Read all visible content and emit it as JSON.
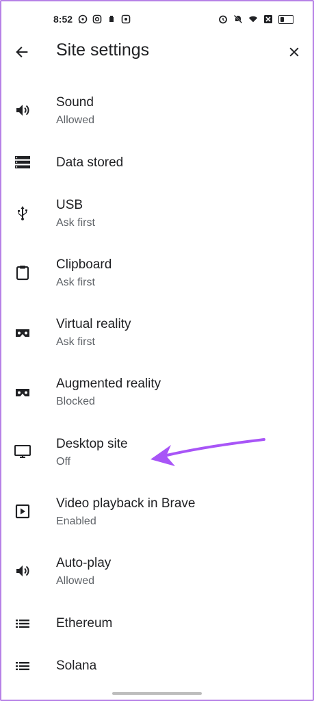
{
  "status_bar": {
    "time": "8:52",
    "left_icons": [
      "whatsapp-icon",
      "instagram-icon",
      "notification-icon",
      "app-icon"
    ],
    "right_icons": [
      "alarm-icon",
      "mute-icon",
      "wifi-icon",
      "signal-off-icon",
      "battery-icon"
    ]
  },
  "header": {
    "title": "Site settings",
    "back_icon": "arrow-back-icon",
    "close_icon": "close-icon"
  },
  "settings": [
    {
      "title": "Sound",
      "subtitle": "Allowed",
      "icon": "volume-icon"
    },
    {
      "title": "Data stored",
      "subtitle": "",
      "icon": "storage-icon"
    },
    {
      "title": "USB",
      "subtitle": "Ask first",
      "icon": "usb-icon"
    },
    {
      "title": "Clipboard",
      "subtitle": "Ask first",
      "icon": "clipboard-icon"
    },
    {
      "title": "Virtual reality",
      "subtitle": "Ask first",
      "icon": "vr-headset-icon"
    },
    {
      "title": "Augmented reality",
      "subtitle": "Blocked",
      "icon": "vr-headset-icon"
    },
    {
      "title": "Desktop site",
      "subtitle": "Off",
      "icon": "desktop-icon"
    },
    {
      "title": "Video playback in Brave",
      "subtitle": "Enabled",
      "icon": "video-playback-icon"
    },
    {
      "title": "Auto-play",
      "subtitle": "Allowed",
      "icon": "volume-icon"
    },
    {
      "title": "Ethereum",
      "subtitle": "",
      "icon": "list-icon"
    },
    {
      "title": "Solana",
      "subtitle": "",
      "icon": "list-icon"
    }
  ],
  "colors": {
    "annotation_arrow": "#a855f7",
    "frame_border": "#b681e6",
    "title_text": "#202124",
    "subtitle_text": "#5f6368"
  }
}
